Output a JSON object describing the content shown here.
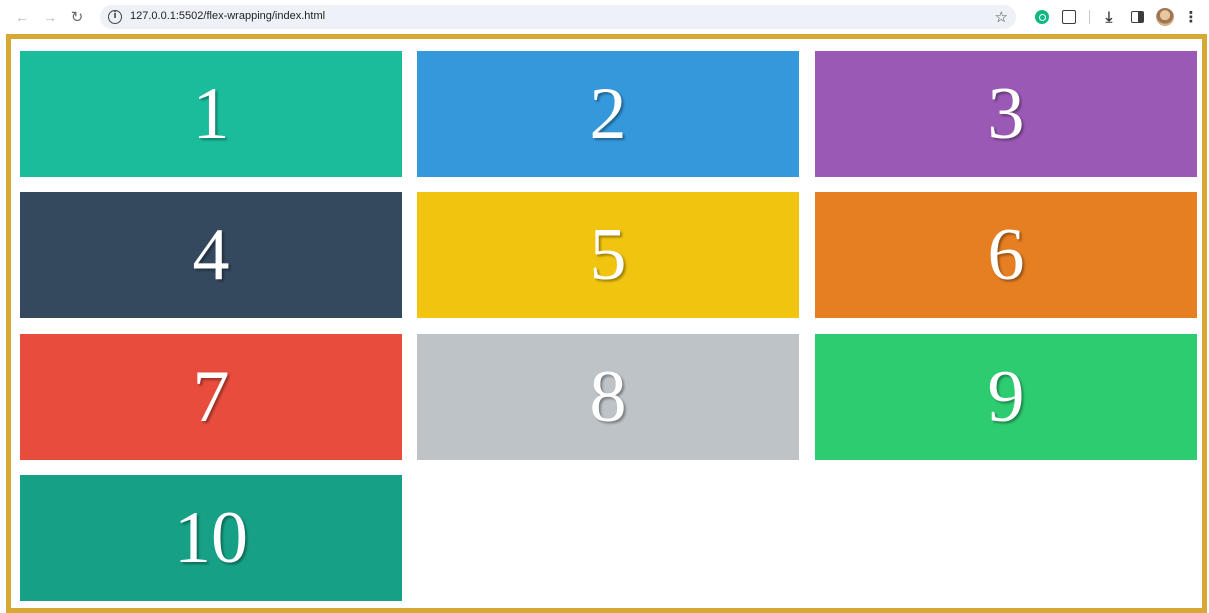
{
  "browser": {
    "back_icon": "arrow-left-icon",
    "forward_icon": "arrow-right-icon",
    "reload_icon": "reload-icon",
    "url": "127.0.0.1:5502/flex-wrapping/index.html",
    "bookmark_icon": "star-icon",
    "extensions": [
      "green-extension-icon",
      "puzzle-icon"
    ],
    "download_icon": "download-icon",
    "side_panel_icon": "side-panel-icon",
    "profile_icon": "avatar",
    "menu_icon": "kebab-menu-icon"
  },
  "page": {
    "container_border_color": "#d8a834",
    "items": [
      {
        "label": "1",
        "color": "#1abc9c"
      },
      {
        "label": "2",
        "color": "#3498db"
      },
      {
        "label": "3",
        "color": "#9b59b6"
      },
      {
        "label": "4",
        "color": "#34495e"
      },
      {
        "label": "5",
        "color": "#f1c40f"
      },
      {
        "label": "6",
        "color": "#e67e22"
      },
      {
        "label": "7",
        "color": "#e74c3c"
      },
      {
        "label": "8",
        "color": "#bdc3c7"
      },
      {
        "label": "9",
        "color": "#2ecc71"
      },
      {
        "label": "10",
        "color": "#16a085"
      }
    ]
  }
}
